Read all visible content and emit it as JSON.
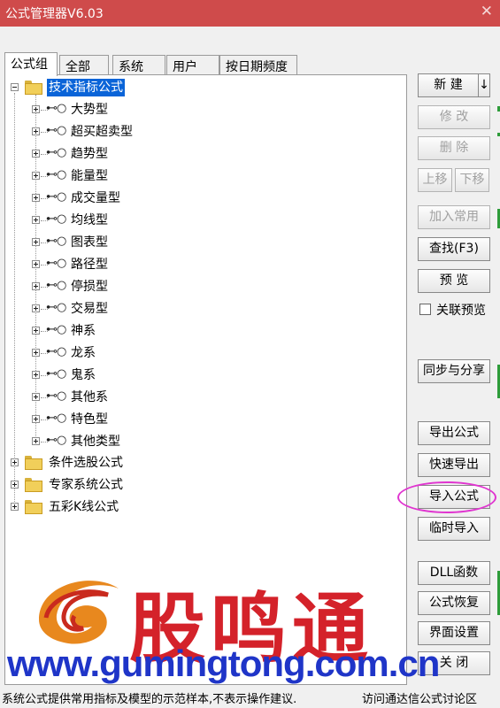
{
  "window": {
    "title": "公式管理器V6.03",
    "close_glyph": "✕"
  },
  "tabs": [
    "公式组",
    "全部",
    "系统",
    "用户",
    "按日期频度"
  ],
  "tree": {
    "root": "技术指标公式",
    "children": [
      "大势型",
      "超买超卖型",
      "趋势型",
      "能量型",
      "成交量型",
      "均线型",
      "图表型",
      "路径型",
      "停损型",
      "交易型",
      "神系",
      "龙系",
      "鬼系",
      "其他系",
      "特色型",
      "其他类型"
    ],
    "groups": [
      "条件选股公式",
      "专家系统公式",
      "五彩K线公式"
    ]
  },
  "buttons": {
    "new": "新  建",
    "new_arrow": "↓",
    "modify": "修  改",
    "delete": "删  除",
    "move_up": "上移",
    "move_down": "下移",
    "add_common": "加入常用",
    "find": "查找(F3)",
    "preview": "预  览",
    "linked_preview": "关联预览",
    "sync_share": "同步与分享",
    "export": "导出公式",
    "quick_export": "快速导出",
    "import": "导入公式",
    "temp_import": "临时导入",
    "dll": "DLL函数",
    "restore": "公式恢复",
    "ui_settings": "界面设置",
    "close": "关  闭"
  },
  "watermark": {
    "brand": "股鸣通",
    "url": "www.gumingtong.com.cn"
  },
  "status": {
    "left": "系统公式提供常用指标及模型的示范样本,不表示操作建议.",
    "right": "访问通达信公式讨论区"
  },
  "colors": {
    "titlebar": "#cf4b4b",
    "selection": "#0a64d8",
    "highlight": "#e035d0",
    "brand_red": "#d4222a",
    "url_blue": "#1f35c8"
  }
}
